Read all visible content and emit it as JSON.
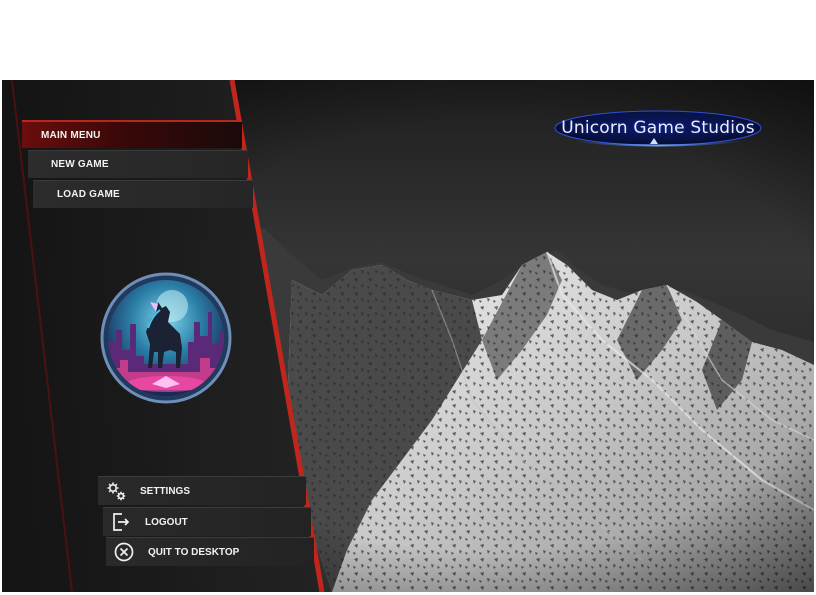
{
  "menu": {
    "main_menu": "MAIN MENU",
    "new_game": "NEW GAME",
    "load_game": "LOAD GAME"
  },
  "bottom_menu": {
    "settings": "SETTINGS",
    "logout": "LOGOUT",
    "quit": "QUIT TO DESKTOP"
  },
  "studio": {
    "name": "Unicorn Game Studios"
  },
  "icons": {
    "settings": "gears-icon",
    "logout": "logout-door-icon",
    "quit": "close-circle-icon",
    "avatar": "unicorn-city-emblem"
  },
  "colors": {
    "accent_red": "#c0261c",
    "panel": "#1b1b1b",
    "logo_glow": "#2f4fd8"
  }
}
